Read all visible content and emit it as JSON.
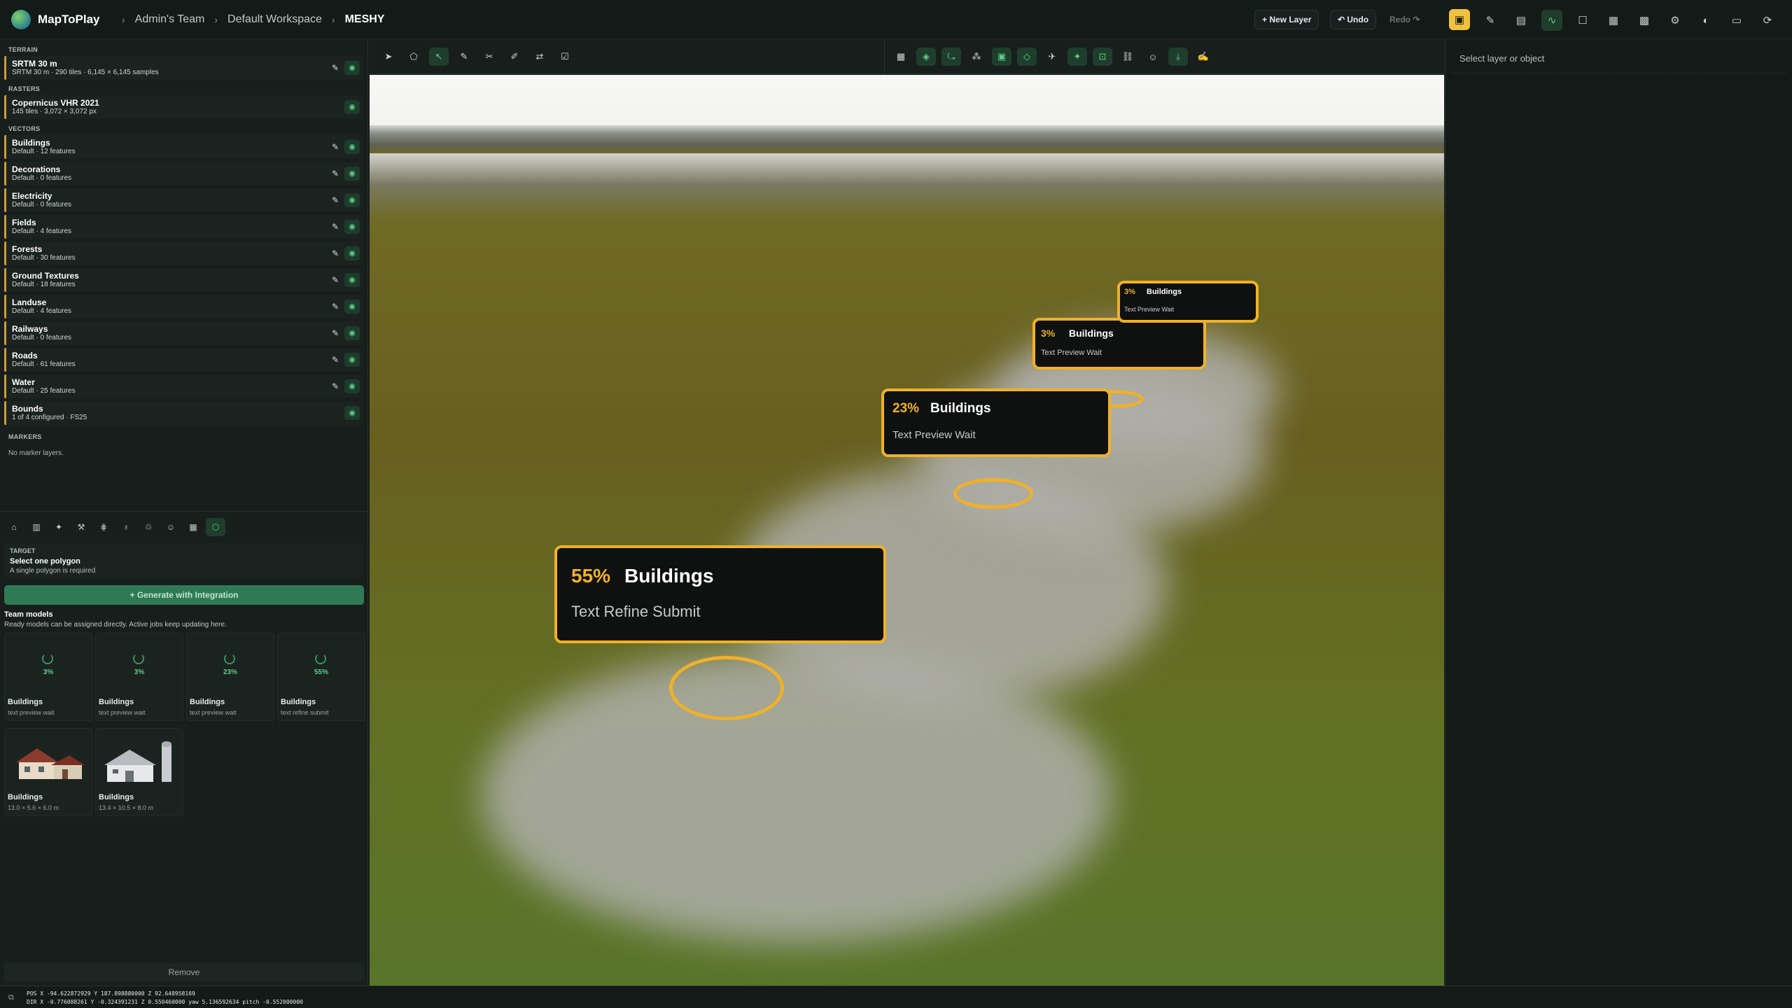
{
  "header": {
    "brand": "MapToPlay",
    "breadcrumbs": [
      "Admin's Team",
      "Default Workspace",
      "MESHY"
    ],
    "new_layer": "+ New Layer",
    "undo": "↶ Undo",
    "redo": "Redo ↷"
  },
  "layers": {
    "terrain_title": "TERRAIN",
    "terrain": [
      {
        "name": "SRTM 30 m",
        "sub": "SRTM 30 m · 290 tiles · 6,145 × 6,145 samples"
      }
    ],
    "rasters_title": "RASTERS",
    "rasters": [
      {
        "name": "Copernicus VHR 2021",
        "sub": "145 tiles · 3,072 × 3,072 px"
      }
    ],
    "vectors_title": "VECTORS",
    "vectors": [
      {
        "name": "Buildings",
        "sub": "Default · 12 features"
      },
      {
        "name": "Decorations",
        "sub": "Default · 0 features"
      },
      {
        "name": "Electricity",
        "sub": "Default · 0 features"
      },
      {
        "name": "Fields",
        "sub": "Default · 4 features"
      },
      {
        "name": "Forests",
        "sub": "Default · 30 features"
      },
      {
        "name": "Ground Textures",
        "sub": "Default · 18 features"
      },
      {
        "name": "Landuse",
        "sub": "Default · 4 features"
      },
      {
        "name": "Railways",
        "sub": "Default · 0 features"
      },
      {
        "name": "Roads",
        "sub": "Default · 61 features"
      },
      {
        "name": "Water",
        "sub": "Default · 25 features"
      },
      {
        "name": "Bounds",
        "sub": "1 of 4 configured · FS25"
      }
    ],
    "markers_title": "MARKERS",
    "no_markers": "No marker layers."
  },
  "generator": {
    "target_label": "TARGET",
    "target_value": "Select one polygon",
    "target_hint": "A single polygon is required",
    "generate": "+ Generate with Integration",
    "team_title": "Team models",
    "team_sub": "Ready models can be assigned directly. Active jobs keep updating here.",
    "cards": [
      {
        "pct": "3%",
        "name": "Buildings",
        "status": "text preview wait"
      },
      {
        "pct": "3%",
        "name": "Buildings",
        "status": "text preview wait"
      },
      {
        "pct": "23%",
        "name": "Buildings",
        "status": "text preview wait"
      },
      {
        "pct": "55%",
        "name": "Buildings",
        "status": "text refine submit"
      }
    ],
    "ready": [
      {
        "name": "Buildings",
        "size": "13.0 × 5.6 × 6.0 m"
      },
      {
        "name": "Buildings",
        "size": "13.4 × 10.5 × 8.0 m"
      }
    ],
    "remove": "Remove"
  },
  "viewport": {
    "labels": [
      {
        "pct": "55%",
        "name": "Buildings",
        "status": "Text Refine Submit"
      },
      {
        "pct": "23%",
        "name": "Buildings",
        "status": "Text Preview Wait"
      },
      {
        "pct": "3%",
        "name": "Buildings",
        "status": "Text Preview Wait"
      },
      {
        "pct": "3%",
        "name": "Buildings",
        "status": "Text Preview Wait"
      }
    ]
  },
  "inspector": {
    "hint": "Select layer or object"
  },
  "status": {
    "pos": "POS X -94.622872929 Y 187.898880000 Z 92.648958169",
    "dir": "DIR X -0.776088261 Y -0.324391231 Z 0.550460000 yaw 5.136592634 pitch -0.552000000"
  },
  "colors": {
    "accent": "#f0b128",
    "green": "#5bd087",
    "panel": "#171e1c"
  }
}
